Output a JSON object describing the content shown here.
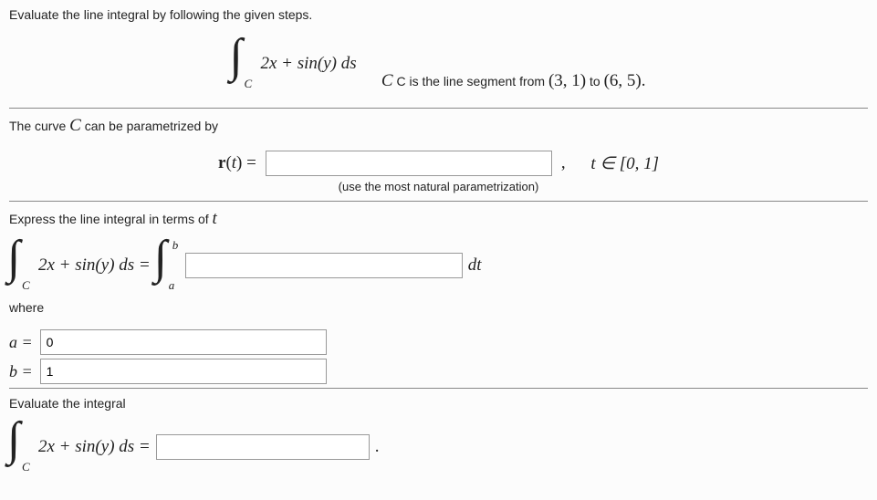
{
  "instruction": "Evaluate the line integral by following the given steps.",
  "problem": {
    "integrand": "2x + sin(y)  ds",
    "curve_desc_prefix": "C is the line segment from ",
    "curve_from": "(3, 1)",
    "curve_to_word": " to ",
    "curve_to": "(6, 5).",
    "curve_label": "C"
  },
  "param_section": {
    "label_prefix": "The curve ",
    "label_curve": "C",
    "label_suffix": " can be parametrized by",
    "r_t_eq": "r(t) = ",
    "domain": "t ∈ [0, 1]",
    "hint": "(use the most natural parametrization)",
    "comma": ","
  },
  "express_section": {
    "label_prefix": "Express the line integral in terms of ",
    "label_var": "t",
    "integrand": "2x + sin(y)  ds = ",
    "dt": "dt",
    "lower_label": "a",
    "upper_label": "b",
    "where": "where",
    "a_label": "a = ",
    "b_label": "b = ",
    "a_value": "0",
    "b_value": "1"
  },
  "eval_section": {
    "label": "Evaluate the integral",
    "integrand": "2x + sin(y)  ds = ",
    "period": "."
  }
}
